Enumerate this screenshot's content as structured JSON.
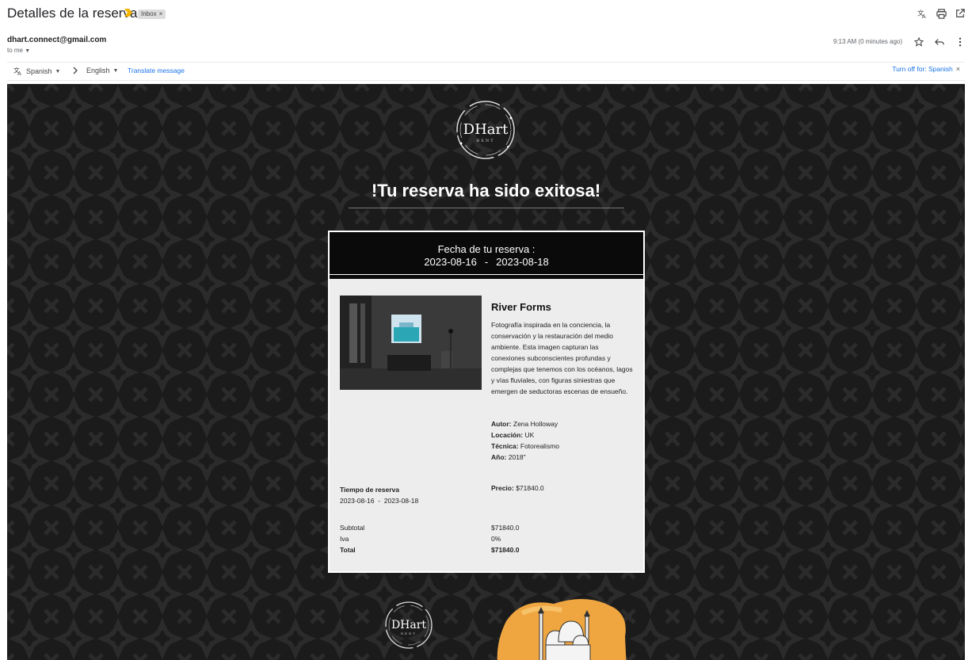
{
  "header": {
    "subject": "Detalles de la reserva",
    "label_chip": "Inbox",
    "label_close": "×"
  },
  "sender": {
    "email": "dhart.connect@gmail.com",
    "to": "to me",
    "time": "9:13 AM (0 minutes ago)"
  },
  "translate": {
    "from_lang": "Spanish",
    "to_lang": "English",
    "translate_link": "Translate message",
    "turn_off": "Turn off for: Spanish"
  },
  "email": {
    "logo_text": "DHart",
    "logo_sub": "RENT",
    "headline": "!Tu reserva ha sido exitosa!",
    "booking_label": "Fecha de tu reserva :",
    "booking_start": "2023-08-16",
    "booking_dash": "-",
    "booking_end": "2023-08-18",
    "art_title": "River Forms",
    "art_description": "Fotografía inspirada en la conciencia, la conservación y la restauración del medio ambiente. Esta imagen capturan las conexiones subconscientes profundas y complejas que tenemos con los océanos, lagos y vías fluviales, con figuras siniestras que emergen de seductoras escenas de ensueño.",
    "autor_label": "Autor:",
    "autor": "Zena Holloway",
    "locacion_label": "Locación:",
    "locacion": "UK",
    "tecnica_label": "Técnica:",
    "tecnica": "Fotorealismo",
    "anio_label": "Año:",
    "anio": "2018\"",
    "tiempo_label": "Tiempo de reserva",
    "tiempo_value": "2023-08-16  -  2023-08-18",
    "precio_label": "Precio:",
    "precio_value": "$71840.0",
    "subtotal_label": "Subtotal",
    "subtotal_value": "$71840.0",
    "iva_label": "Iva",
    "iva_value": "0%",
    "total_label": "Total",
    "total_value": "$71840.0"
  },
  "colors": {
    "email_bg": "#1b1b1b",
    "link_blue": "#1a73e8",
    "card_bg": "#ededed",
    "importance": "#f4b400"
  }
}
